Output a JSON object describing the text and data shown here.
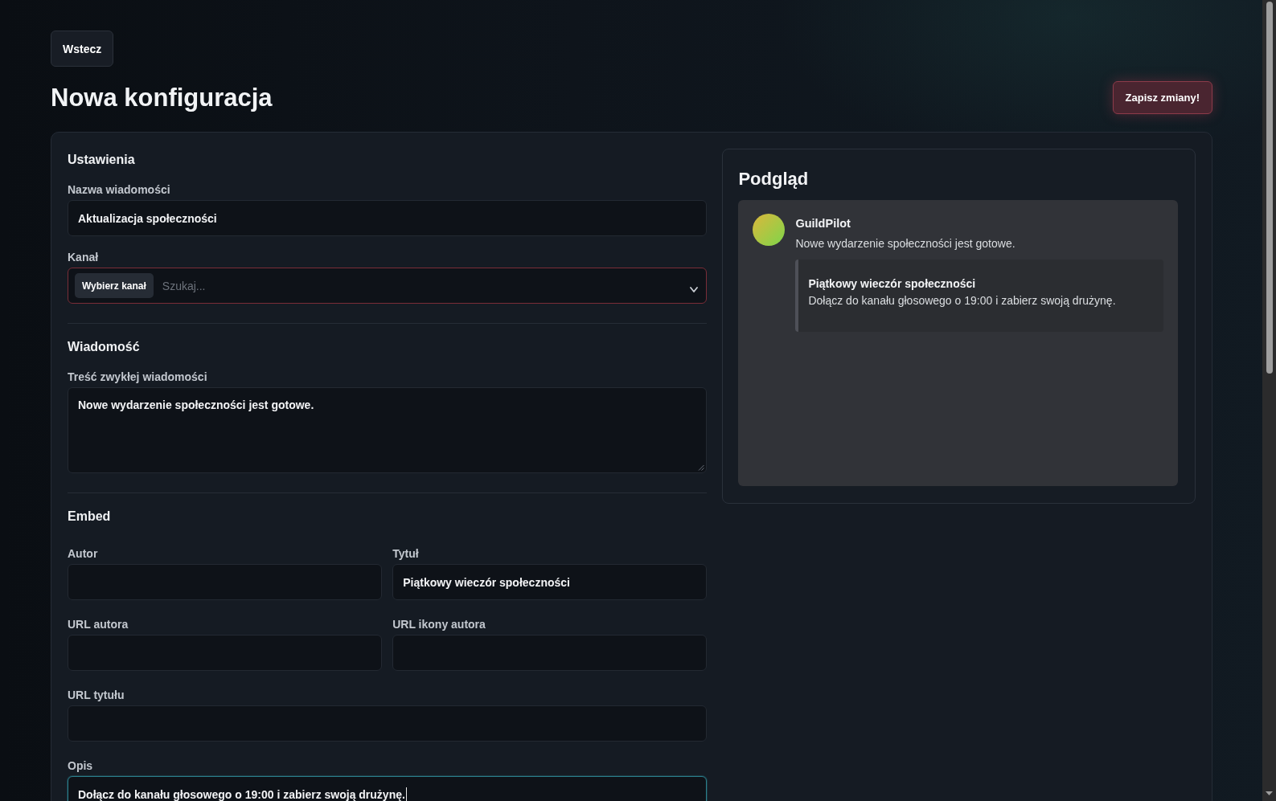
{
  "back_button": {
    "label": "Wstecz"
  },
  "page_title": "Nowa konfiguracja",
  "save_button": {
    "label": "Zapisz zmiany!"
  },
  "settings": {
    "heading": "Ustawienia",
    "message_name": {
      "label": "Nazwa wiadomości",
      "value": "Aktualizacja społeczności"
    },
    "channel": {
      "label": "Kanał",
      "button": "Wybierz kanał",
      "placeholder": "Szukaj...",
      "error": true
    }
  },
  "message": {
    "heading": "Wiadomość",
    "content": {
      "label": "Treść zwykłej wiadomości",
      "value": "Nowe wydarzenie społeczności jest gotowe."
    }
  },
  "embed": {
    "heading": "Embed",
    "rows": [
      [
        {
          "label": "Autor",
          "focused": false
        },
        {
          "label": "Tytuł",
          "value": "Piątkowy wieczór społeczności",
          "focused": false
        }
      ],
      [
        {
          "label": "URL autora",
          "focused": false
        },
        {
          "label": "URL ikony autora",
          "focused": false
        }
      ],
      [
        {
          "label": "URL tytułu",
          "focused": false
        }
      ],
      [
        {
          "label": "Opis",
          "value": "Dołącz do kanału głosowego o 19:00 i zabierz swoją drużynę.",
          "focused": true
        }
      ]
    ]
  },
  "preview": {
    "heading": "Podgląd",
    "bot_name": "GuildPilot",
    "content": "Nowe wydarzenie społeczności jest gotowe.",
    "embed": {
      "title": "Piątkowy wieczór społeczności",
      "description": "Dołącz do kanału głosowego o 19:00 i zabierz swoją drużynę."
    }
  }
}
